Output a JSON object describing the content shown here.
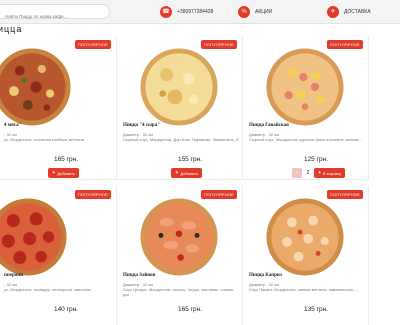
{
  "topbar": {
    "search_placeholder": "Найти Пиццу по назва кафе...",
    "phone": {
      "label": "+380977284428",
      "icon": "phone-icon"
    },
    "promo": {
      "label": "АКЦИИ",
      "icon": "percent-icon"
    },
    "delivery": {
      "label": "ДОСТАВКА",
      "icon": "scooter-icon"
    },
    "accent_color": "#e23b2a"
  },
  "heading": "ицца",
  "products": [
    {
      "badge": "ПОПУЛЯРНОЕ",
      "title": "4 мяса\"",
      "diameter": "- 32 см",
      "ingredients": "ус, Моцарелла, копченая колбаса, ветчина",
      "price": "165 грн.",
      "button": "Добавить",
      "quantity": null,
      "variant": "meat"
    },
    {
      "badge": "ПОПУЛЯРНОЕ",
      "title": "Пицца \"4 сыра\"",
      "diameter": "Диаметр - 32 см",
      "ingredients": "Сырный соус, Моцарелла, Дор Блю, Пармезан, Эмменталь, З",
      "price": "155 грн.",
      "button": "Добавить",
      "quantity": null,
      "variant": "cheese"
    },
    {
      "badge": "ПОПУЛЯРНОЕ",
      "title": "Пицца Гавайская",
      "diameter": "Диаметр - 32 см",
      "ingredients": "Сырный соус, Моцарелла, куриное филе копченое, ананас...",
      "price": "125 грн.",
      "button": "В корзину",
      "quantity": "2",
      "variant": "hawaii"
    },
    {
      "badge": "ПОПУЛЯРНОЕ",
      "title": "пперони",
      "diameter": "- 32 см",
      "ingredients": "ус, Моцарелла, помидор, пепперони, маслины,",
      "price": "140 грн.",
      "button": "",
      "quantity": null,
      "variant": "pepperoni"
    },
    {
      "badge": "ПОПУЛЯРНОЕ",
      "title": "Пицца Salmon",
      "diameter": "Диаметр - 32 см",
      "ingredients": "Соус Цезарь, Моцарелла, лосось, Черри, маслины, оливки, рук",
      "price": "165 грн.",
      "button": "",
      "quantity": null,
      "variant": "salmon"
    },
    {
      "badge": "ПОПУЛЯРНОЕ",
      "title": "Пицца Каприз",
      "diameter": "Диаметр - 32 см",
      "ingredients": "Соус Пикант, Моцарелла, свиная ветчина, шампиньоны, ...",
      "price": "135 грн.",
      "button": "",
      "quantity": null,
      "variant": "capri"
    }
  ]
}
